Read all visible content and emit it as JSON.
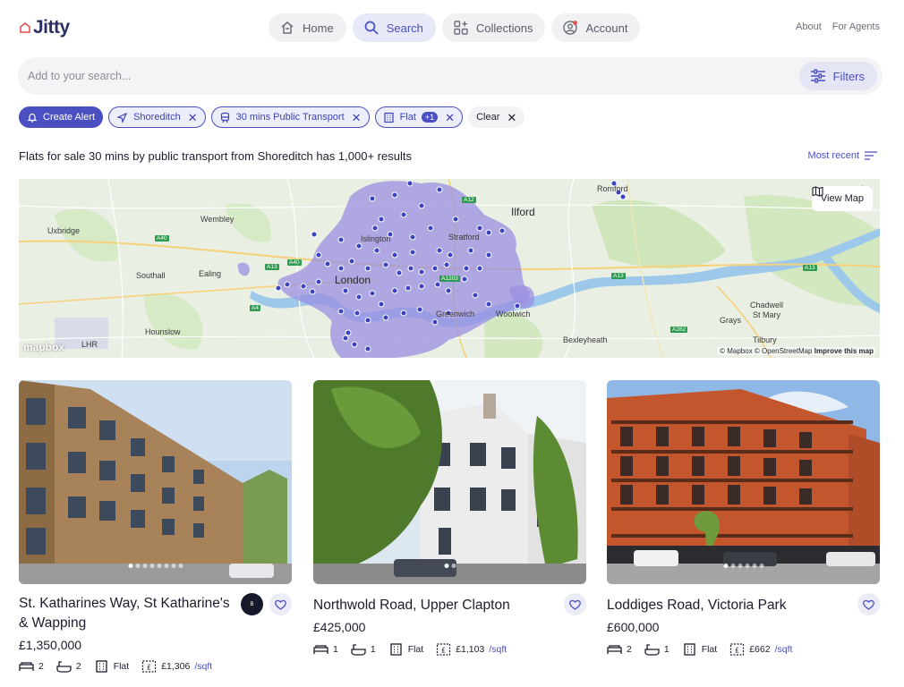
{
  "brand": {
    "name": "Jitty",
    "accent": "#4a4fc2"
  },
  "nav": {
    "items": [
      {
        "label": "Home",
        "icon": "home-icon"
      },
      {
        "label": "Search",
        "icon": "search-icon"
      },
      {
        "label": "Collections",
        "icon": "collections-icon"
      },
      {
        "label": "Account",
        "icon": "account-icon"
      }
    ]
  },
  "top_links": {
    "about": "About",
    "agents": "For Agents"
  },
  "search": {
    "placeholder": "Add to your search...",
    "filters_label": "Filters"
  },
  "chips": {
    "create_alert": "Create Alert",
    "location": "Shoreditch",
    "transport": "30 mins Public Transport",
    "type": "Flat",
    "type_count": "+1",
    "clear": "Clear"
  },
  "results": {
    "summary": "Flats for sale 30 mins by public transport from Shoreditch has 1,000+ results",
    "sort_label": "Most recent"
  },
  "map": {
    "view_map": "View Map",
    "attribution": "© Mapbox © OpenStreetMap",
    "improve": "Improve this map",
    "logo": "mapbox",
    "labels": {
      "romford": "Romford",
      "ilford": "Ilford",
      "wembley": "Wembley",
      "uxbridge": "Uxbridge",
      "islington": "Islington",
      "stratford": "Stratford",
      "southall": "Southall",
      "ealing": "Ealing",
      "london": "London",
      "greenwich": "Greenwich",
      "woolwich": "Woolwich",
      "chadwell": "Chadwell",
      "st_mary": "St Mary",
      "grays": "Grays",
      "hounslow": "Hounslow",
      "bexleyheath": "Bexleyheath",
      "tilbury": "Tilbury",
      "lhr": "LHR",
      "lon_partial": "lon"
    },
    "roads": [
      "A40",
      "A40",
      "A12",
      "A13",
      "A13",
      "A4",
      "A282",
      "A13",
      "A1203"
    ]
  },
  "listings": [
    {
      "title": "St. Katharines Way, St Katharine's & Wapping",
      "price": "£1,350,000",
      "beds": "2",
      "baths": "2",
      "type": "Flat",
      "price_sqft": "£1,306",
      "sqft_unit": "/sqft",
      "agent_logo": "B"
    },
    {
      "title": "Northwold Road, Upper Clapton",
      "price": "£425,000",
      "beds": "1",
      "baths": "1",
      "type": "Flat",
      "price_sqft": "£1,103",
      "sqft_unit": "/sqft"
    },
    {
      "title": "Loddiges Road, Victoria Park",
      "price": "£600,000",
      "beds": "2",
      "baths": "1",
      "type": "Flat",
      "price_sqft": "£662",
      "sqft_unit": "/sqft"
    }
  ]
}
